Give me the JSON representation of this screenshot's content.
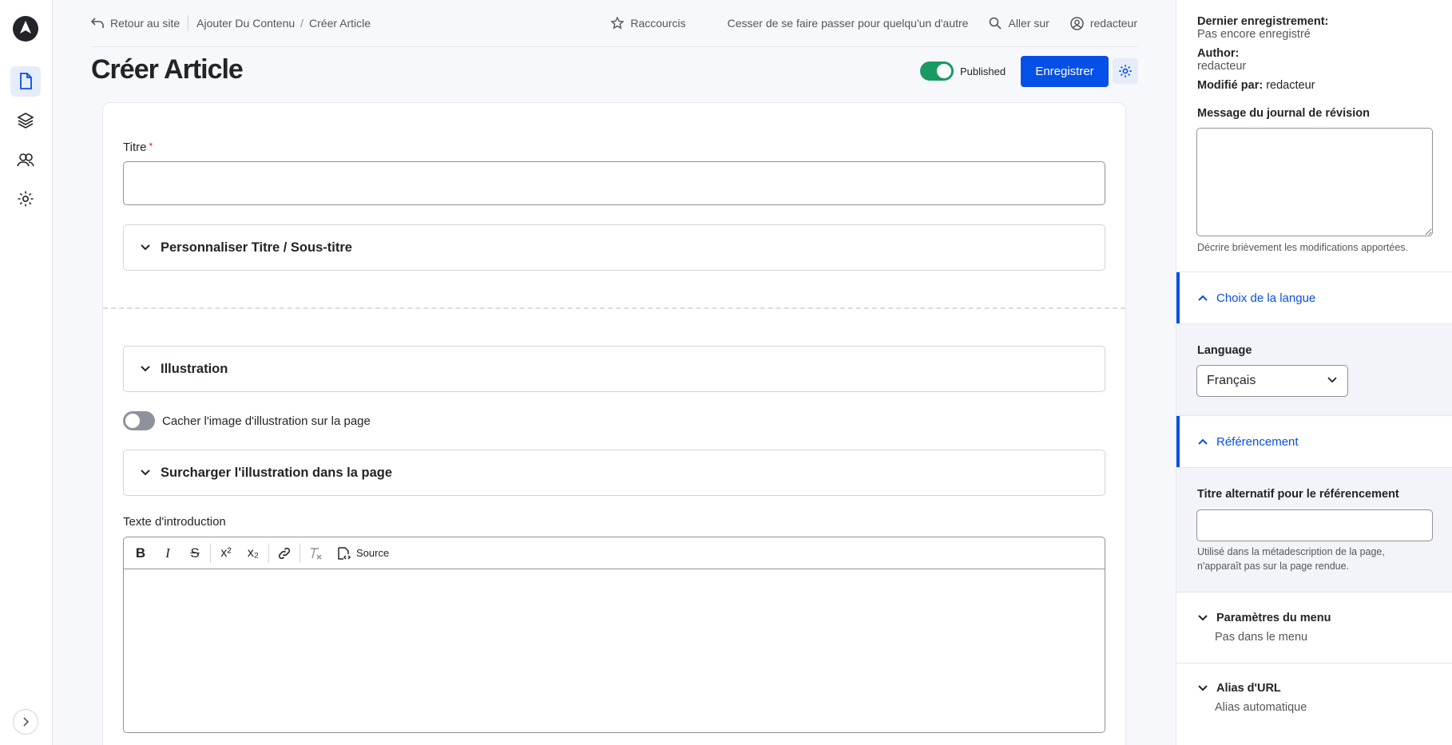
{
  "topbar": {
    "back_label": "Retour au site",
    "crumbs": [
      "Ajouter Du Contenu",
      "Créer Article"
    ],
    "shortcuts_label": "Raccourcis",
    "stop_impersonate_label": "Cesser de se faire passer pour quelqu'un d'autre",
    "goto_label": "Aller sur",
    "user_label": "redacteur"
  },
  "header": {
    "title": "Créer Article",
    "published_label": "Published",
    "save_label": "Enregistrer"
  },
  "form": {
    "title_label": "Titre",
    "title_value": "",
    "accordion_subtitle": "Personnaliser Titre / Sous-titre",
    "accordion_illustration": "Illustration",
    "hide_image_label": "Cacher l'image d'illustration sur la page",
    "accordion_override": "Surcharger l'illustration dans la page",
    "intro_label": "Texte d'introduction",
    "editor_toolbar": {
      "bold": "B",
      "italic": "I",
      "strike": "S",
      "superscript": "x²",
      "subscript": "x₂",
      "source_label": "Source"
    }
  },
  "sidebar": {
    "last_saved_label": "Dernier enregistrement:",
    "last_saved_value": "Pas encore enregistré",
    "author_label": "Author:",
    "author_value": "redacteur",
    "modified_label": "Modifié par:",
    "modified_value": "redacteur",
    "revision_label": "Message du journal de révision",
    "revision_value": "",
    "revision_help": "Décrire brièvement les modifications apportées.",
    "language_section": "Choix de la langue",
    "language_label": "Language",
    "language_value": "Français",
    "seo_section": "Référencement",
    "seo_title_label": "Titre alternatif pour le référencement",
    "seo_title_value": "",
    "seo_help_1": "Utilisé dans la métadescription de la page,",
    "seo_help_2": "n'apparaît pas sur la page rendue.",
    "menu_label": "Paramètres du menu",
    "menu_value": "Pas dans le menu",
    "alias_label": "Alias d'URL",
    "alias_value": "Alias automatique"
  },
  "colors": {
    "accent": "#0550e6",
    "published_toggle": "#1a9a63",
    "required_star": "#d72222"
  }
}
